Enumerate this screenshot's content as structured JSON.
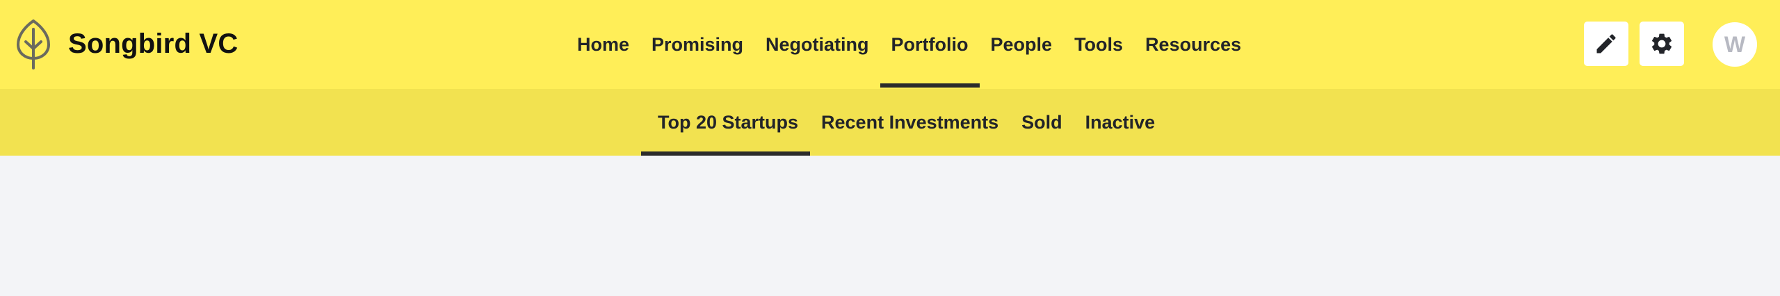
{
  "brand": {
    "name": "Songbird VC",
    "icon": "leaf-icon"
  },
  "main_nav": [
    {
      "label": "Home",
      "active": false
    },
    {
      "label": "Promising",
      "active": false
    },
    {
      "label": "Negotiating",
      "active": false
    },
    {
      "label": "Portfolio",
      "active": true
    },
    {
      "label": "People",
      "active": false
    },
    {
      "label": "Tools",
      "active": false
    },
    {
      "label": "Resources",
      "active": false
    }
  ],
  "actions": {
    "edit_icon": "pencil-icon",
    "settings_icon": "gear-icon"
  },
  "user": {
    "avatar_initial": "W"
  },
  "sub_nav": [
    {
      "label": "Top 20 Startups",
      "active": true
    },
    {
      "label": "Recent Investments",
      "active": false
    },
    {
      "label": "Sold",
      "active": false
    },
    {
      "label": "Inactive",
      "active": false
    }
  ],
  "colors": {
    "topbar": "#ffee58",
    "subbar": "#f2e250",
    "background": "#f3f4f7",
    "text": "#222429",
    "active_indicator": "#2b2b2b"
  }
}
